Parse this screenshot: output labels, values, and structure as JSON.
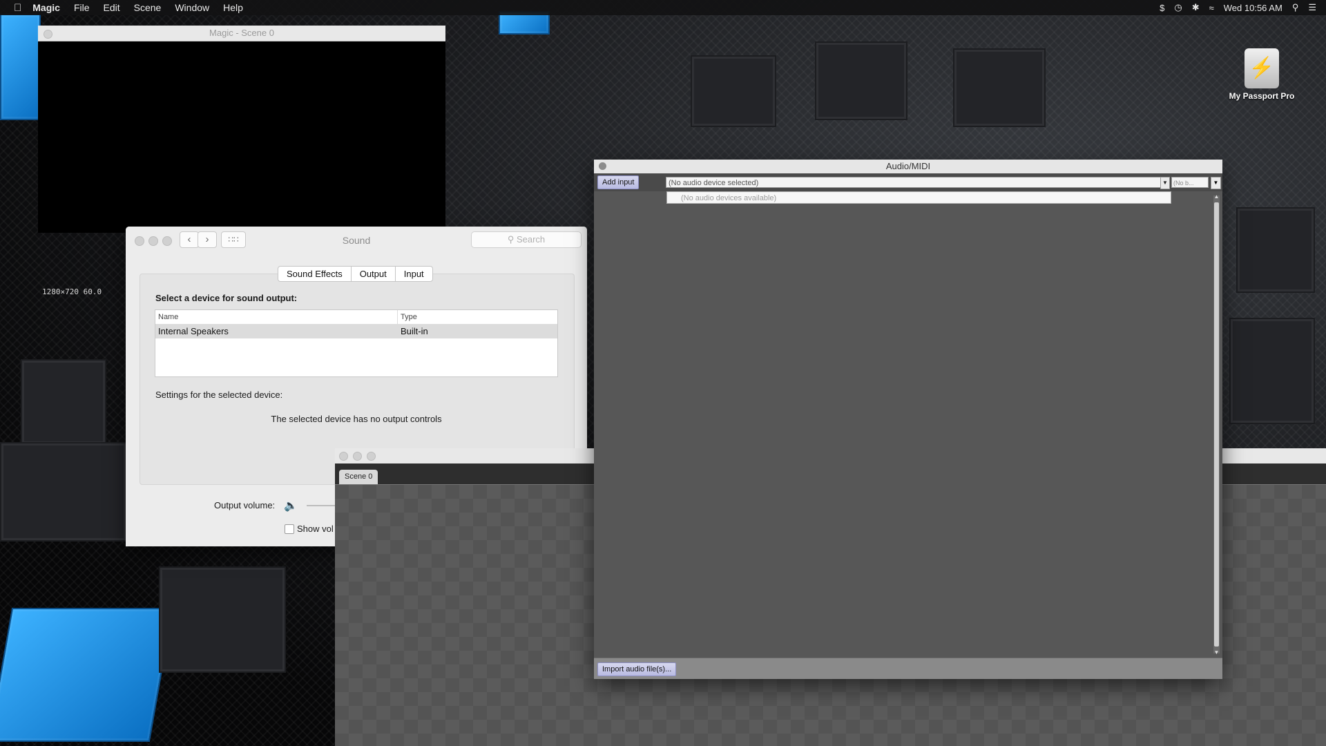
{
  "menubar": {
    "app": "Magic",
    "items": [
      "File",
      "Edit",
      "Scene",
      "Window",
      "Help"
    ],
    "clock": "Wed 10:56 AM"
  },
  "desktop": {
    "drive_label": "My Passport Pro"
  },
  "magic_window": {
    "title": "Magic - Scene 0",
    "resolution_info": "1280×720  60.0"
  },
  "sound_window": {
    "title": "Sound",
    "search_placeholder": "Search",
    "tabs": [
      "Sound Effects",
      "Output",
      "Input"
    ],
    "selected_tab": "Output",
    "heading": "Select a device for sound output:",
    "table": {
      "columns": [
        "Name",
        "Type"
      ],
      "rows": [
        [
          "Internal Speakers",
          "Built-in"
        ]
      ]
    },
    "settings_label": "Settings for the selected device:",
    "no_controls": "The selected device has no output controls",
    "output_volume_label": "Output volume:",
    "show_volume_partial": "Show vol"
  },
  "scene_window": {
    "tab": "Scene 0"
  },
  "audio_window": {
    "title": "Audio/MIDI",
    "add_input": "Add input",
    "device_select": "(No audio device selected)",
    "device_select_small": "(No b...",
    "popup_item": "(No audio devices available)",
    "import_button": "Import audio file(s)..."
  }
}
